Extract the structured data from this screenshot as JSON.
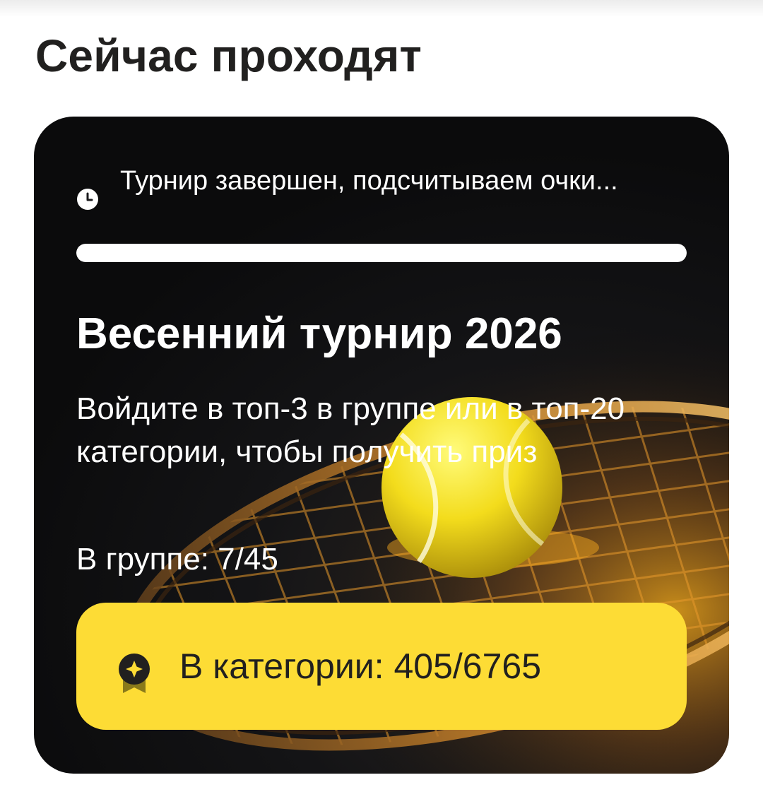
{
  "section": {
    "title": "Сейчас проходят"
  },
  "tournament": {
    "status_icon": "clock-icon",
    "status_text": "Турнир завершен, подсчитываем очки...",
    "progress_fraction": 1.0,
    "title": "Весенний турнир 2026",
    "description": "Войдите в топ-3 в группе или в топ-20 категории, чтобы получить приз",
    "group_rank": "В группе: 7/45",
    "category_icon": "badge-star-icon",
    "category_rank": "В категории: 405/6765",
    "background_image": "tennis-ball-on-racket",
    "colors": {
      "card_bg": "#141416",
      "accent_yellow": "#fddc35",
      "text_light": "#ffffff",
      "text_dark": "#21201f"
    }
  }
}
